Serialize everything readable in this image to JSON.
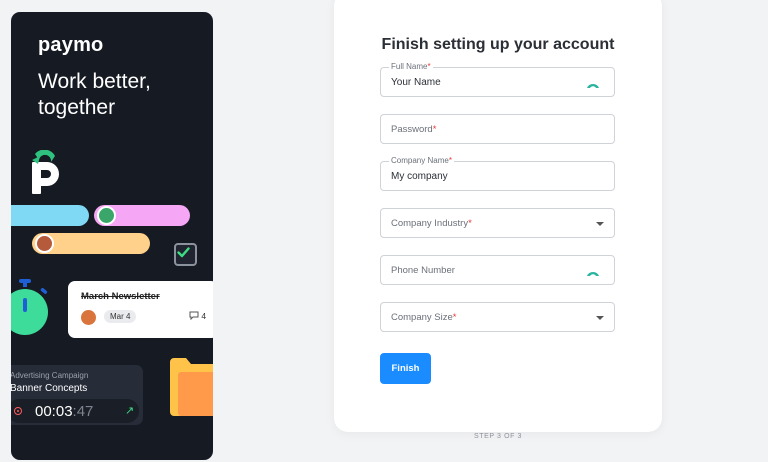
{
  "promo": {
    "brand": "paymo",
    "tagline": "Work better, together",
    "card": {
      "title": "March Newsletter",
      "date": "Mar 4",
      "comments": "4"
    },
    "timer": {
      "campaign": "Advertising Campaign",
      "task": "Banner Concepts",
      "time_main": "00:03",
      "time_sec": ":47"
    }
  },
  "form": {
    "title": "Finish setting up your account",
    "full_name": {
      "label": "Full Name",
      "value": "Your Name"
    },
    "password": {
      "label": "Password"
    },
    "company_name": {
      "label": "Company Name",
      "value": "My company"
    },
    "industry": {
      "label": "Company Industry"
    },
    "phone": {
      "label": "Phone Number"
    },
    "company_size": {
      "label": "Company Size"
    },
    "finish_label": "Finish",
    "required_mark": "*"
  },
  "step": "STEP 3 OF 3",
  "colors": {
    "accent": "#1a8cff",
    "brand_green": "#3ddc84",
    "panel": "#161a22"
  }
}
